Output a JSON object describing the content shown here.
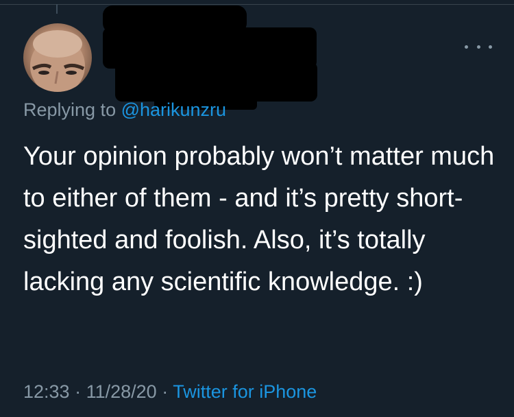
{
  "tweet": {
    "replying_prefix": "Replying to ",
    "replying_handle": "@harikunzru",
    "text": "Your opinion probably won’t matter much to either of them - and it’s pretty short-sighted and foolish. Also, it’s totally lacking any scientific knowledge. :)",
    "time": "12:33",
    "date": "11/28/20",
    "separator": " · ",
    "source": "Twitter for iPhone"
  },
  "colors": {
    "background": "#15202b",
    "primary_text": "#ffffff",
    "secondary_text": "#8899a6",
    "link": "#1b95e0"
  },
  "icons": {
    "more": "more-horizontal-icon"
  }
}
